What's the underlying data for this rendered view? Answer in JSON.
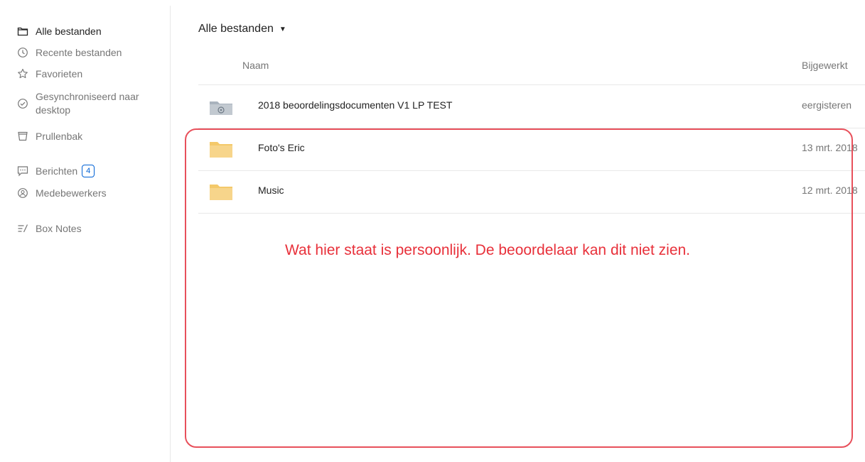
{
  "sidebar": {
    "items": [
      {
        "label": "Alle bestanden",
        "icon": "folder-outline-icon"
      },
      {
        "label": "Recente bestanden",
        "icon": "clock-icon"
      },
      {
        "label": "Favorieten",
        "icon": "star-icon"
      },
      {
        "label": "Gesynchroniseerd naar desktop",
        "icon": "sync-check-icon"
      },
      {
        "label": "Prullenbak",
        "icon": "trash-icon"
      },
      {
        "label": "Berichten",
        "icon": "chat-icon",
        "badge": "4"
      },
      {
        "label": "Medebewerkers",
        "icon": "person-circle-icon"
      },
      {
        "label": "Box Notes",
        "icon": "notes-icon"
      }
    ],
    "sync_line1": "Gesynchroniseerd naar",
    "sync_line2": "desktop"
  },
  "main": {
    "breadcrumb": "Alle bestanden",
    "columns": {
      "name": "Naam",
      "updated": "Bijgewerkt"
    },
    "rows": [
      {
        "name": "2018 beoordelingsdocumenten V1 LP TEST",
        "date": "eergisteren",
        "type": "shared-folder"
      },
      {
        "name": "Foto's Eric",
        "date": "13 mrt. 2018",
        "type": "folder"
      },
      {
        "name": "Music",
        "date": "12 mrt. 2018",
        "type": "folder"
      }
    ]
  },
  "annotation": {
    "text": "Wat hier staat is persoonlijk. De beoordelaar kan dit niet zien.",
    "color": "#e8303a"
  },
  "colors": {
    "accent": "#0061d5",
    "folder": "#f7d58b",
    "shared_folder": "#a9b3bd"
  }
}
